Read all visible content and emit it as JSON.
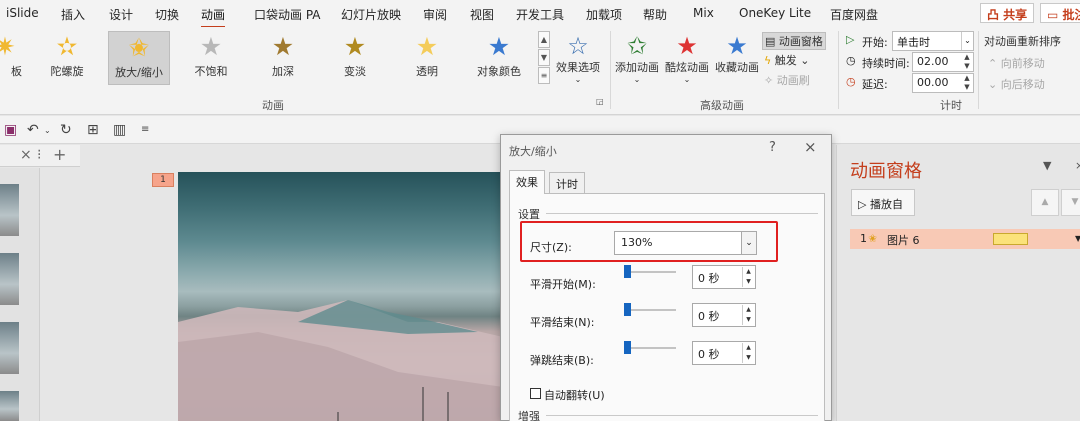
{
  "menu": {
    "items": [
      "iSlide",
      "插入",
      "设计",
      "切换",
      "动画",
      "口袋动画 PA",
      "幻灯片放映",
      "审阅",
      "视图",
      "开发工具",
      "加载项",
      "帮助",
      "Mix",
      "OneKey Lite",
      "百度网盘"
    ],
    "active": "动画",
    "share": "凸 共享",
    "comment": "▭ 批注"
  },
  "ribbon": {
    "effects": [
      {
        "label": "板",
        "icon": "star-effect-icon",
        "color": "#f0b830"
      },
      {
        "label": "陀螺旋",
        "icon": "star-spin-icon",
        "color": "#f0b830"
      },
      {
        "label": "放大/缩小",
        "icon": "star-grow-icon",
        "color": "#f0b830",
        "selected": true
      },
      {
        "label": "不饱和",
        "icon": "star-desaturate-icon",
        "color": "#b8b8b8"
      },
      {
        "label": "加深",
        "icon": "star-darken-icon",
        "color": "#a07a30"
      },
      {
        "label": "变淡",
        "icon": "star-lighten-icon",
        "color": "#b08a20"
      },
      {
        "label": "透明",
        "icon": "star-transparency-icon",
        "color": "#f4cc5a"
      },
      {
        "label": "对象颜色",
        "icon": "star-object-color-icon",
        "color": "#3a7ad0"
      }
    ],
    "effect_options": "效果选项",
    "animation_group": "动画",
    "add_animation": "添加动画",
    "cool_animation": "酷炫动画",
    "collect_animation": "收藏动画",
    "animation_pane_btn": "动画窗格",
    "trigger": "触发",
    "anim_painter": "动画刷",
    "advanced_group": "高级动画",
    "start_label": "开始:",
    "start_value": "单击时",
    "duration_label": "持续时间:",
    "duration_value": "02.00",
    "delay_label": "延迟:",
    "delay_value": "00.00",
    "reorder_title": "对动画重新排序",
    "move_earlier": "向前移动",
    "move_later": "向后移动",
    "timing_group": "计时"
  },
  "tabstrip": {
    "close": "×",
    "more": "⁝",
    "add": "+"
  },
  "slide": {
    "number": "1"
  },
  "dialog": {
    "title": "放大/缩小",
    "help": "?",
    "close": "×",
    "tabs": [
      "效果",
      "计时"
    ],
    "settings_section": "设置",
    "size_label": "尺寸(Z):",
    "size_value": "130%",
    "smooth_start_label": "平滑开始(M):",
    "smooth_start_value": "0 秒",
    "smooth_end_label": "平滑结束(N):",
    "smooth_end_value": "0 秒",
    "bounce_end_label": "弹跳结束(B):",
    "bounce_end_value": "0 秒",
    "auto_reverse_label": "自动翻转(U)",
    "enhance_section": "增强"
  },
  "anim_pane": {
    "title": "动画窗格",
    "play_from": "播放自",
    "row_index": "1",
    "row_label": "图片 6"
  }
}
